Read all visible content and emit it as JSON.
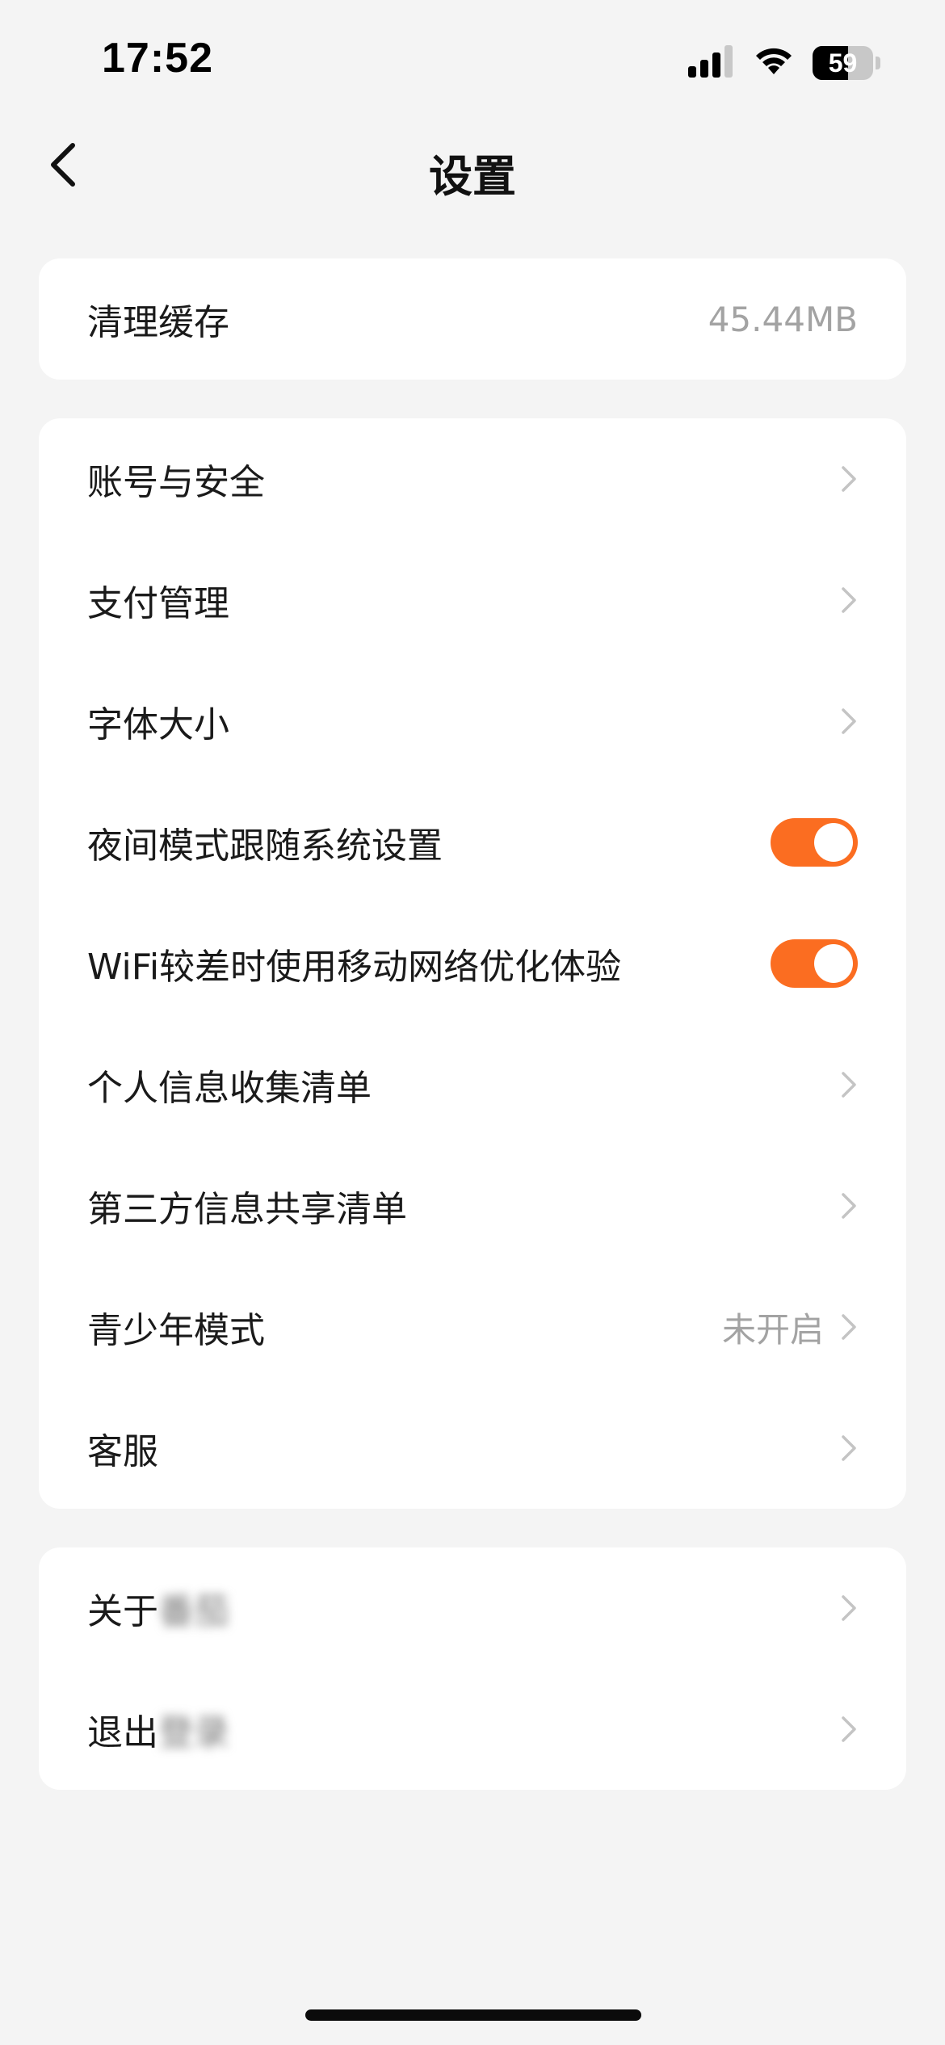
{
  "status_bar": {
    "time": "17:52",
    "battery_level": "59",
    "battery_fraction": 0.59,
    "icons": [
      "cellular-signal-icon",
      "wifi-icon",
      "battery-icon"
    ]
  },
  "nav": {
    "title": "设置",
    "back_icon": "chevron-left-icon"
  },
  "cache_card": {
    "label": "清理缓存",
    "value": "45.44MB"
  },
  "settings_card": {
    "account_security": "账号与安全",
    "payment": "支付管理",
    "font_size": "字体大小",
    "night_mode": {
      "label": "夜间模式跟随系统设置",
      "enabled": true
    },
    "wifi_optimize": {
      "label": "WiFi较差时使用移动网络优化体验",
      "enabled": true
    },
    "personal_info": "个人信息收集清单",
    "third_party": "第三方信息共享清单",
    "teen_mode": {
      "label": "青少年模式",
      "value": "未开启"
    },
    "customer_service": "客服"
  },
  "about_card": {
    "about_prefix": "关于",
    "about_blurred": "番茄",
    "logout_prefix": "退出",
    "logout_blurred": "登录"
  },
  "colors": {
    "accent": "#fb6d21",
    "background": "#f4f4f4",
    "card": "#ffffff",
    "secondary_text": "#a3a3a3",
    "chevron": "#c4c4c4"
  }
}
